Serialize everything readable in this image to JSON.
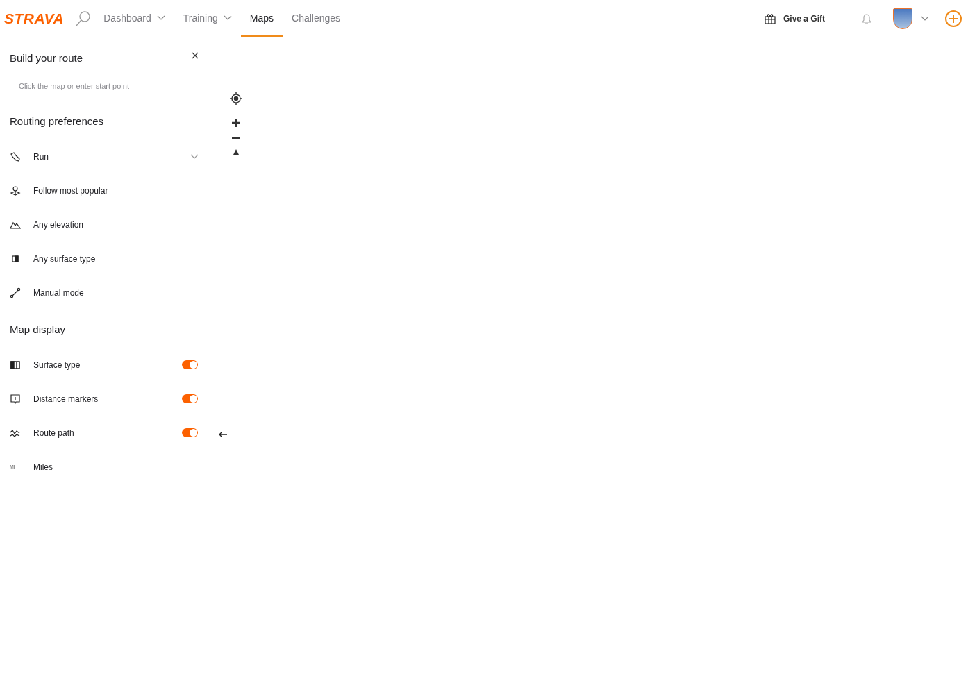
{
  "nav": {
    "logo": "STRAVA",
    "items": [
      {
        "label": "Dashboard",
        "dropdown": true,
        "selected": false
      },
      {
        "label": "Training",
        "dropdown": true,
        "selected": false
      },
      {
        "label": "Maps",
        "dropdown": false,
        "selected": true
      },
      {
        "label": "Challenges",
        "dropdown": false,
        "selected": false
      }
    ],
    "gift": "Give a Gift"
  },
  "panel": {
    "title": "Build your route",
    "start_placeholder": "Click the map or enter start point",
    "routing_title": "Routing preferences",
    "routing": [
      {
        "kind": "shoe",
        "label": "Run",
        "dropdown": true
      },
      {
        "kind": "popular",
        "label": "Follow most popular",
        "dropdown": false
      },
      {
        "kind": "elevation",
        "label": "Any elevation",
        "dropdown": false
      },
      {
        "kind": "surface",
        "label": "Any surface type",
        "dropdown": false
      },
      {
        "kind": "manual",
        "label": "Manual mode",
        "dropdown": false
      }
    ],
    "display_title": "Map display",
    "display": [
      {
        "kind": "surface2",
        "label": "Surface type",
        "on": true
      },
      {
        "kind": "markers",
        "label": "Distance markers",
        "on": true
      },
      {
        "kind": "path",
        "label": "Route path",
        "on": true
      },
      {
        "kind": "units",
        "unit_mark": "MI",
        "label": "Miles"
      }
    ]
  }
}
